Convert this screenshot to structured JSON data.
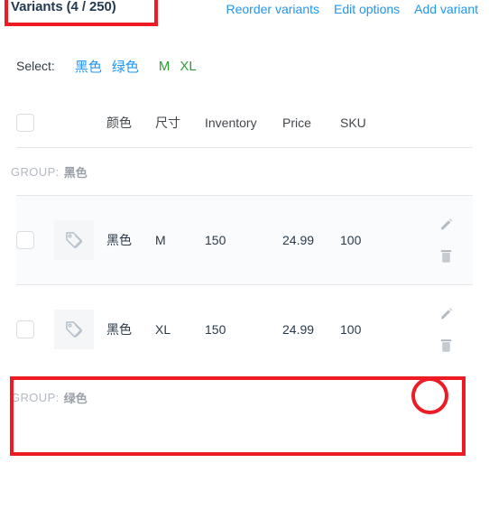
{
  "header": {
    "title": "Variants (4 / 250)",
    "actions": [
      {
        "label": "Reorder variants",
        "name": "reorder-variants-link"
      },
      {
        "label": "Edit options",
        "name": "edit-options-link"
      },
      {
        "label": "Add variant",
        "name": "add-variant-link"
      }
    ]
  },
  "select": {
    "label": "Select:",
    "options": [
      {
        "label": "黑色",
        "color": "#2196f3"
      },
      {
        "label": "绿色",
        "color": "#2196f3"
      },
      {
        "label": "M",
        "color": "#2e9b34"
      },
      {
        "label": "XL",
        "color": "#2e9b34"
      }
    ]
  },
  "table": {
    "columns": [
      "颜色",
      "尺寸",
      "Inventory",
      "Price",
      "SKU"
    ],
    "groups": [
      {
        "label": "GROUP:",
        "value": "黑色",
        "rows": [
          {
            "color": "黑色",
            "size": "M",
            "inventory": "150",
            "price": "24.99",
            "sku": "100"
          },
          {
            "color": "黑色",
            "size": "XL",
            "inventory": "150",
            "price": "24.99",
            "sku": "100"
          }
        ]
      },
      {
        "label": "GROUP:",
        "value": "绿色",
        "rows": []
      }
    ],
    "row_actions": {
      "edit": "edit-pencil-icon",
      "delete": "trash-icon"
    }
  },
  "annotations": {
    "accent": "#ed1c24",
    "title_highlight": "Variants (4 / 250)",
    "row_highlight": "黑色 XL variant row",
    "circle_target": "edit-pencil-icon"
  }
}
